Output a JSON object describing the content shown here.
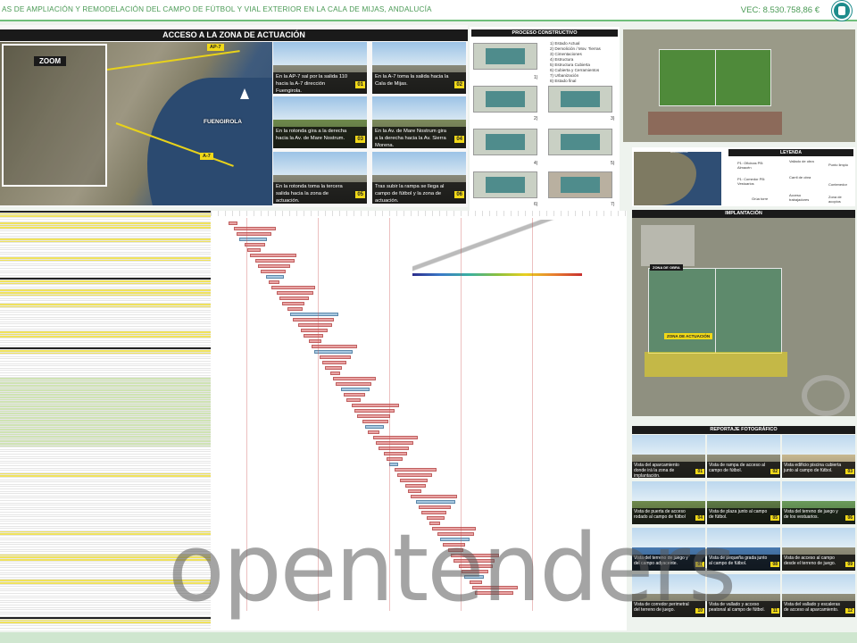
{
  "header": {
    "title": "AS DE AMPLIACIÓN Y REMODELACIÓN DEL CAMPO DE FÚTBOL Y VIAL EXTERIOR EN LA CALA DE MIJAS, ANDALUCÍA",
    "vec": "VEC: 8.530.758,86 €"
  },
  "access": {
    "title": "ACCESO A LA ZONA DE ACTUACIÓN",
    "map": {
      "zoom_label": "ZOOM",
      "tags": [
        "AP-7",
        "A-7"
      ],
      "places": [
        "FUENGIROLA"
      ]
    },
    "photos": [
      {
        "caption": "En la AP-7 sal por la salida 110 hacia la A-7 dirección Fuengirola.",
        "num": "01"
      },
      {
        "caption": "En la A-7 toma la salida hacia la Cala de Mijas.",
        "num": "02"
      },
      {
        "caption": "En la rotonda gira a la derecha hacia la Av. de Mare Nostrum.",
        "num": "03"
      },
      {
        "caption": "En la Av. de Mare Nostrum gira a la derecha hacia la Av. Sierra Morena.",
        "num": "04"
      },
      {
        "caption": "En la rotonda toma la tercera salida hacia la zona de actuación.",
        "num": "05"
      },
      {
        "caption": "Tras subir la rampa se llega al campo de fútbol y la zona de actuación.",
        "num": "06"
      }
    ]
  },
  "process": {
    "title": "PROCESO CONSTRUCTIVO",
    "steps": [
      "1) Estado Actual",
      "2) Demolición / Mov. Tierras",
      "3) Cimentaciones",
      "4) Estructura",
      "5) Estructura Cubierta",
      "6) Cubierta y Cerramientos",
      "7) Urbanización",
      "8) Estado final"
    ],
    "image_numbers": [
      "1)",
      "2)",
      "3)",
      "4)",
      "5)",
      "6)",
      "7)"
    ]
  },
  "legend": {
    "title": "LEYENDA",
    "location_label": "UBICACIÓN",
    "items": [
      "P1: Oficinas PB: Almacén",
      "P1: Comedor PB: Vestuarios",
      "Vallado de obra",
      "Carril de obra",
      "Punto limpio",
      "Contenedor",
      "Grúa torre",
      "Acceso trabajadores",
      "Zona de acopios"
    ]
  },
  "implantation": {
    "title": "IMPLANTACIÓN",
    "labels": [
      "ZONA DE ACTUACIÓN",
      "ZONA DE OBRA"
    ]
  },
  "report": {
    "title": "REPORTAJE FOTOGRÁFICO",
    "photos": [
      {
        "caption": "Vista del aparcamiento donde irá la zona de implantación.",
        "num": "01"
      },
      {
        "caption": "Vista de rampa de acceso al campo de fútbol.",
        "num": "02"
      },
      {
        "caption": "Vista edificio piscina cubierta junto al campo de fútbol.",
        "num": "03"
      },
      {
        "caption": "Vista de puerta de acceso rodado al campo de fútbol",
        "num": "04"
      },
      {
        "caption": "Vista de plaza junto al campo de fútbol.",
        "num": "05"
      },
      {
        "caption": "Vista del terreno de juego y de los vestuarios.",
        "num": "06"
      },
      {
        "caption": "Vista del terreno de juego y del campo adyacente.",
        "num": "07"
      },
      {
        "caption": "Vista de pequeña grada junto al campo de fútbol.",
        "num": "08"
      },
      {
        "caption": "Vista de acceso al campo desde el terreno de juego.",
        "num": "09"
      },
      {
        "caption": "Vista de corredor perimetral del terreno de juego.",
        "num": "10"
      },
      {
        "caption": "Vista de vallado y acceso peatonal al campo de fútbol.",
        "num": "11"
      },
      {
        "caption": "Vista del vallado y escaleras de acceso al aparcamiento.",
        "num": "12"
      }
    ]
  },
  "watermark": "opentenders",
  "colors": {
    "accent_green": "#6fbf7a",
    "highlight_yellow": "#f0d818",
    "dark_bar": "#1a1a1a"
  }
}
